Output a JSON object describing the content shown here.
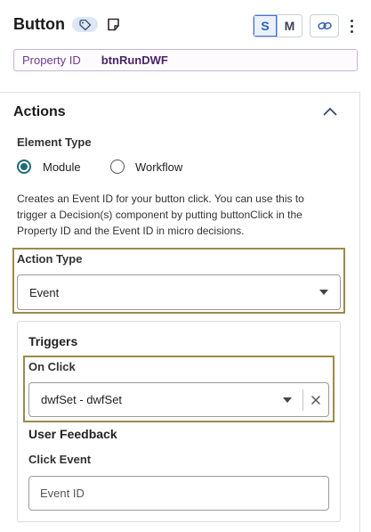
{
  "header": {
    "title": "Button",
    "size_toggle": {
      "s_label": "S",
      "m_label": "M",
      "active": "S"
    },
    "property_id_label": "Property ID",
    "property_id_value": "btnRunDWF"
  },
  "actions": {
    "section_title": "Actions",
    "element_type": {
      "label": "Element Type",
      "options": [
        {
          "label": "Module",
          "checked": true
        },
        {
          "label": "Workflow",
          "checked": false
        }
      ]
    },
    "description": "Creates an Event ID for your button click. You can use this to trigger a Decision(s) component by putting buttonClick in the Property ID and the Event ID in micro decisions.",
    "action_type": {
      "label": "Action Type",
      "value": "Event"
    },
    "triggers": {
      "title": "Triggers",
      "on_click": {
        "label": "On Click",
        "value": "dwfSet - dwfSet"
      },
      "user_feedback_title": "User Feedback",
      "click_event": {
        "label": "Click Event",
        "placeholder": "Event ID"
      }
    }
  },
  "colors": {
    "accent_teal": "#1e6b73",
    "highlight_border": "#9b8a4b",
    "property_purple": "#6e3d8c",
    "active_blue": "#3b72d9"
  },
  "icons": [
    "tag-icon",
    "note-icon",
    "link-icon",
    "kebab-menu-icon",
    "chevron-up-icon",
    "caret-down-icon",
    "clear-icon"
  ]
}
